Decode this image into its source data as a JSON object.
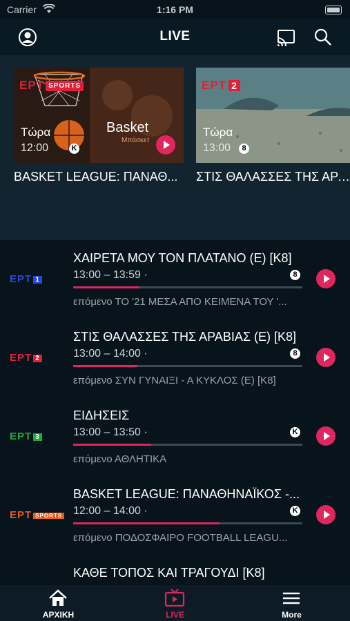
{
  "status": {
    "carrier": "Carrier",
    "time": "1:16 PM"
  },
  "header": {
    "title": "LIVE"
  },
  "featured": [
    {
      "logo": "ΕΡΤ",
      "logo_sub": "SPORTS",
      "thumb_text": "Basket",
      "thumb_sub": "Μπάσκετ",
      "now": "Τώρα",
      "time": "12:00",
      "rating": "K",
      "title": "BASKET LEAGUE: ΠΑΝΑΘ..."
    },
    {
      "logo": "ΕΡΤ",
      "logo_sub": "2",
      "now": "Τώρα",
      "time": "13:00",
      "rating": "8",
      "title": "ΣΤΙΣ ΘΑΛΑΣΣΕΣ ΤΗΣ ΑΡΑ..."
    }
  ],
  "channels": [
    {
      "logo": "ΕΡΤ",
      "num": "1",
      "color": "#2a4ad6",
      "title": "ΧΑΙΡΕΤΑ ΜΟΥ ΤΟΝ ΠΛΑΤΑΝΟ (Ε) [Κ8]",
      "time": "13:00 – 13:59 ·",
      "rating": "8",
      "progress": 0.29,
      "next": "επόμενο ΤΟ '21 ΜΕΣΑ ΑΠΟ ΚΕΙΜΕΝΑ ΤΟΥ '..."
    },
    {
      "logo": "ΕΡΤ",
      "num": "2",
      "color": "#e0203a",
      "title": "ΣΤΙΣ ΘΑΛΑΣΣΕΣ ΤΗΣ ΑΡΑΒΙΑΣ (Ε) [Κ8]",
      "time": "13:00 – 14:00 ·",
      "rating": "8",
      "progress": 0.28,
      "next": "επόμενο ΣΥΝ ΓΥΝΑΙΞΙ - Α ΚΥΚΛΟΣ (Ε) [Κ8]"
    },
    {
      "logo": "ΕΡΤ",
      "num": "3",
      "color": "#1faa3a",
      "title": "ΕΙΔΗΣΕΙΣ",
      "time": "13:00 – 13:50 ·",
      "rating": "K",
      "progress": 0.34,
      "next": "επόμενο ΑΘΛΗΤΙΚΑ"
    },
    {
      "logo": "ΕΡΤ",
      "num": "SPORTS",
      "color": "#e85a1a",
      "title": "BASKET LEAGUE: ΠΑΝΑΘΗΝΑΪΚΟΣ -...",
      "time": "12:00 – 14:00 ·",
      "rating": "K",
      "progress": 0.64,
      "next": "επόμενο ΠΟΔΟΣΦΑΙΡΟ FOOTBALL LEAGU..."
    },
    {
      "logo": "",
      "num": "",
      "color": "#ffffff",
      "title": "ΚΑΘΕ ΤΟΠΟΣ ΚΑΙ ΤΡΑΓΟΥΔΙ [Κ8]",
      "time": "",
      "rating": "",
      "progress": 0,
      "next": ""
    }
  ],
  "tabs": [
    {
      "label": "ΑΡΧΙΚΗ",
      "icon": "home-icon"
    },
    {
      "label": "LIVE",
      "icon": "live-tv-icon",
      "active": true
    },
    {
      "label": "More",
      "icon": "menu-icon"
    }
  ],
  "colors": {
    "accent": "#e0265f",
    "background": "#08141c",
    "hero": "#12242f"
  }
}
